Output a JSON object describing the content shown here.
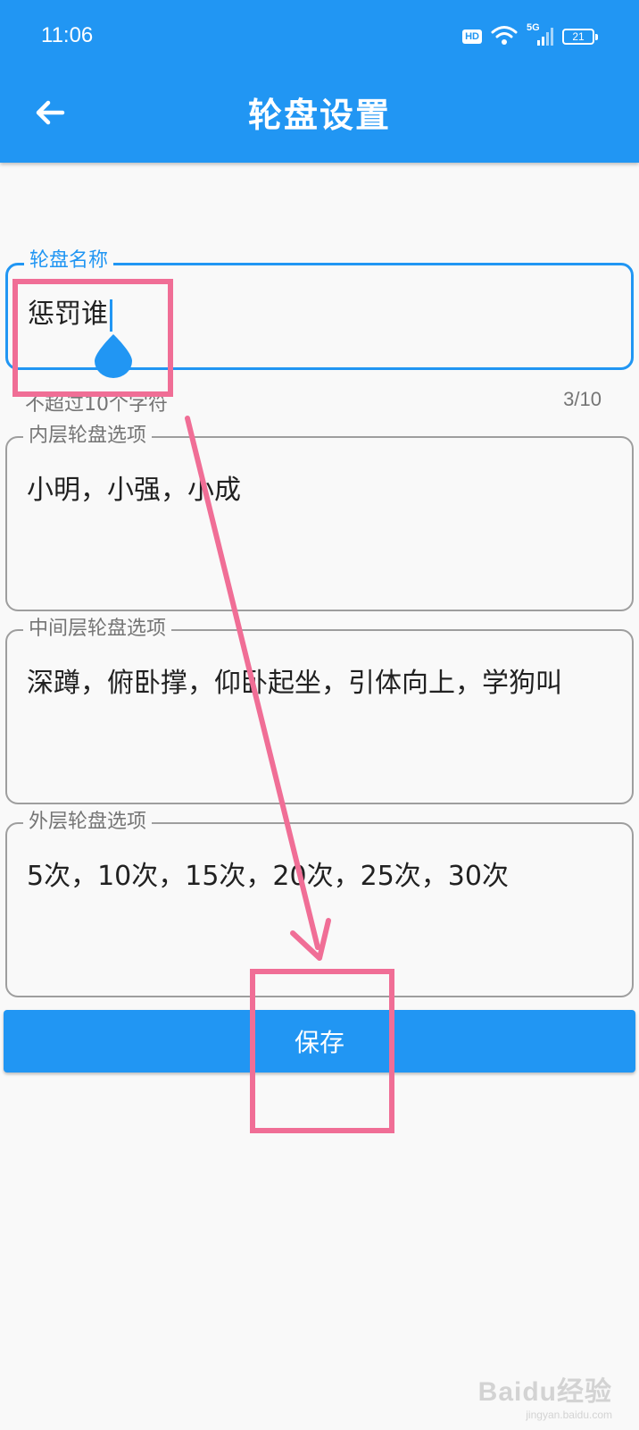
{
  "status_bar": {
    "time": "11:06",
    "hd_badge": "HD",
    "network_label": "5G",
    "battery_level": "21",
    "icons": [
      "hd-icon",
      "wifi-icon",
      "cellular-signal-icon",
      "battery-icon"
    ]
  },
  "header": {
    "title": "轮盘设置",
    "back_icon": "arrow-left-icon"
  },
  "form": {
    "wheel_name": {
      "label": "轮盘名称",
      "value": "惩罚谁",
      "helper": "不超过10个字符",
      "counter": "3/10"
    },
    "inner_options": {
      "label": "内层轮盘选项",
      "value": "小明，小强，小成"
    },
    "middle_options": {
      "label": "中间层轮盘选项",
      "value": "深蹲，俯卧撑，仰卧起坐，引体向上，学狗叫"
    },
    "outer_options": {
      "label": "外层轮盘选项",
      "value": "5次，10次，15次，20次，25次，30次"
    },
    "save_label": "保存"
  },
  "watermark": {
    "logo": "Baidu经验",
    "url": "jingyan.baidu.com"
  },
  "colors": {
    "primary": "#2196f3",
    "annotation": "#f06e96",
    "background": "#f9f9f9"
  }
}
